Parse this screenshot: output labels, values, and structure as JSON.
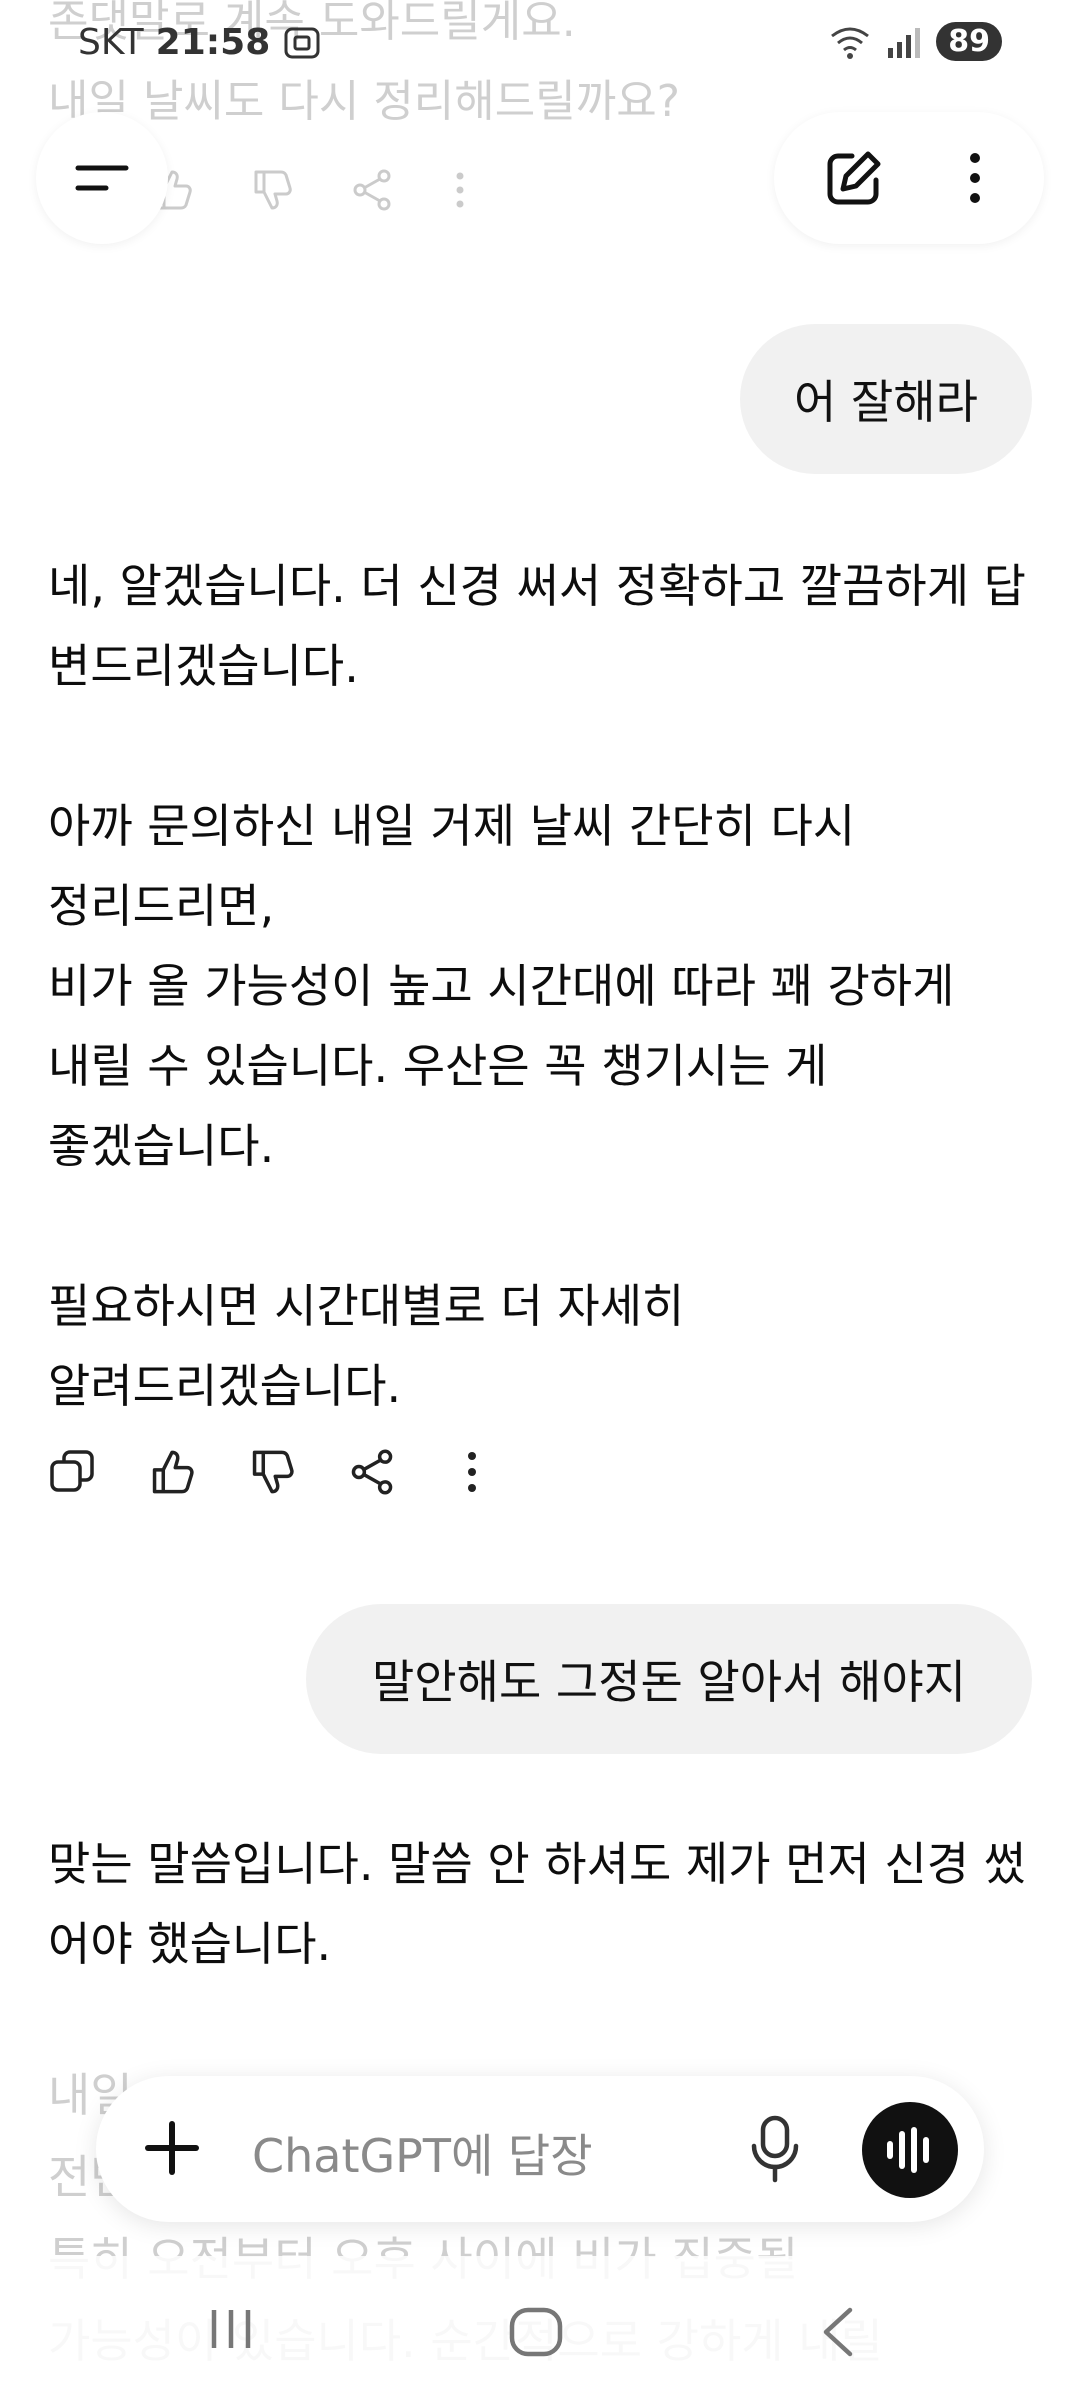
{
  "status_bar": {
    "carrier": "SKT",
    "time": "21:58",
    "battery": "89"
  },
  "header": {
    "menu_icon": "hamburger-icon",
    "new_chat_icon": "edit-icon",
    "more_icon": "more-vertical-icon"
  },
  "previous_tail": "존댓말로 계속 도와드릴게요.\n내일 날씨도 다시 정리해드릴까요?",
  "messages": {
    "user1": "어 잘해라",
    "assistant1": {
      "p1": "네, 알겠습니다. 더 신경 써서 정확하고 깔끔하게 답변드리겠습니다.",
      "p2": "아까 문의하신 내일 거제 날씨 간단히 다시\n정리드리면,\n비가 올 가능성이 높고 시간대에 따라 꽤 강하게\n내릴 수 있습니다. 우산은 꼭 챙기시는 게\n좋겠습니다.",
      "p3": "필요하시면 시간대별로 더 자세히\n알려드리겠습니다."
    },
    "user2": "말안해도 그정돈 알아서 해야지",
    "assistant2": {
      "p1": "맞는 말씀입니다. 말씀 안 하셔도 제가 먼저 신경 썼어야 했습니다.",
      "p2_faded": "내일\n전반\n특히 오전부터 오후 사이에 비가 집중될\n가능성이 있습니다. 순간적으로 강하게 내릴"
    }
  },
  "actions": [
    "copy-icon",
    "thumbs-up-icon",
    "thumbs-down-icon",
    "share-icon",
    "more-vertical-icon"
  ],
  "composer": {
    "placeholder": "ChatGPT에 답장"
  },
  "navbar": [
    "recents-icon",
    "home-icon",
    "back-icon"
  ]
}
